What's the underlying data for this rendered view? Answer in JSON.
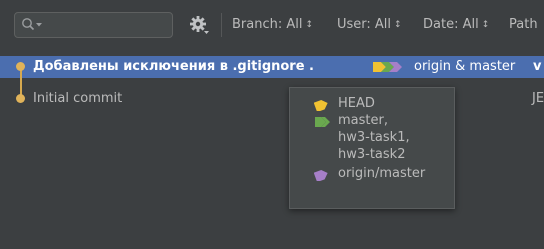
{
  "toolbar": {
    "search": {
      "value": "",
      "placeholder": ""
    },
    "filters": [
      {
        "label": "Branch: All"
      },
      {
        "label": "User: All"
      },
      {
        "label": "Date: All"
      },
      {
        "label": "Path"
      }
    ],
    "filter_arrows": "↕"
  },
  "commits": [
    {
      "message": "Добавлены исключения в .gitignore .",
      "refs": "origin & master",
      "author_prefix": "v",
      "selected": true
    },
    {
      "message": "Initial commit",
      "refs": "",
      "author_prefix": "JE",
      "selected": false
    }
  ],
  "popup": {
    "entries": [
      {
        "icon": "yellow-tag-icon",
        "lines": [
          "HEAD"
        ]
      },
      {
        "icon": "green-tag-icon",
        "lines": [
          "master,",
          "hw3-task1,",
          "hw3-task2"
        ]
      },
      {
        "icon": "purple-tag-icon",
        "lines": [
          "origin/master"
        ]
      }
    ]
  },
  "colors": {
    "background": "#3c3f41",
    "selection": "#4b6eaf",
    "graph_line": "#d6a94f",
    "tag_yellow": "#f1c232",
    "tag_green": "#6aa84f",
    "tag_purple": "#a67fc8"
  }
}
